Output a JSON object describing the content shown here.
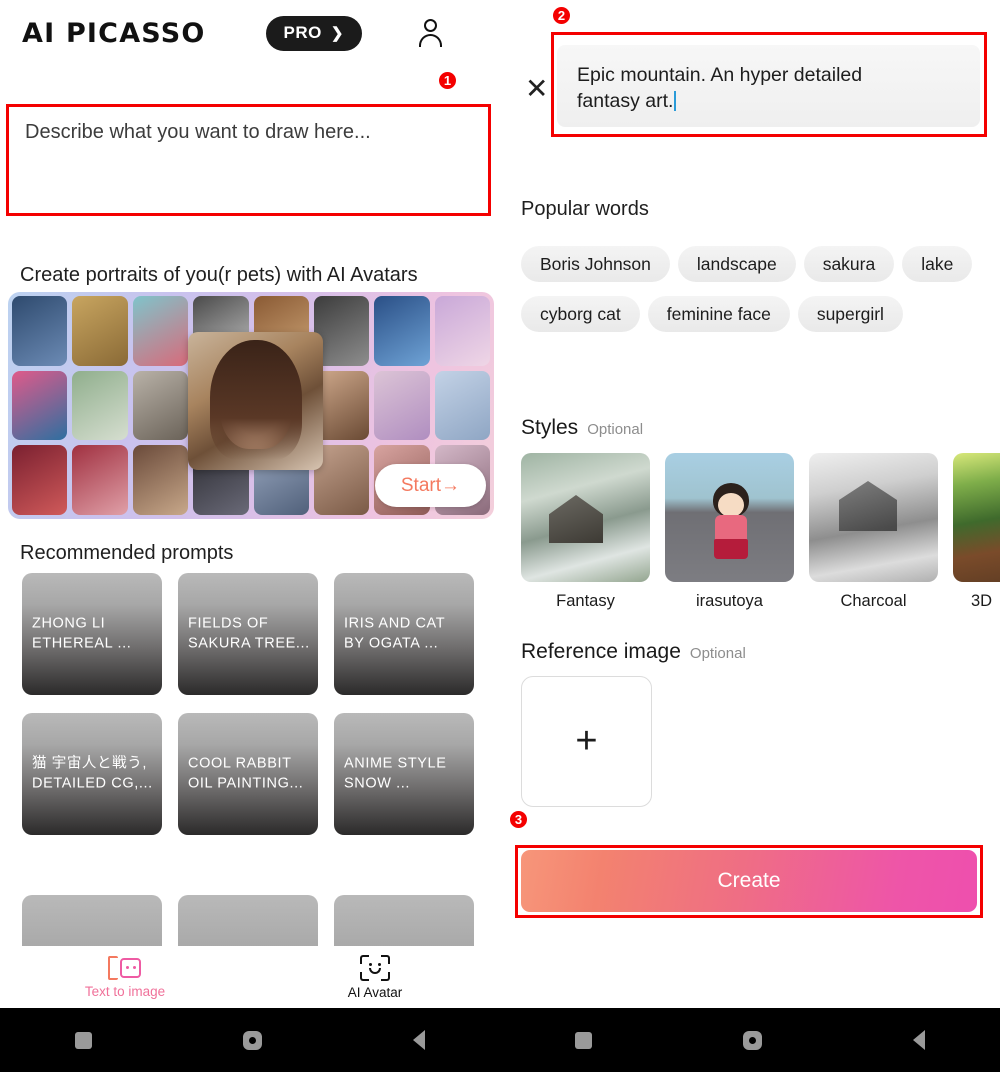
{
  "app": {
    "brand": "AI PICASSO",
    "pro_label": "PRO",
    "pro_caret": "❯"
  },
  "left": {
    "prompt_input": {
      "placeholder": "Describe what you want to draw here...",
      "value": ""
    },
    "avatar_banner": {
      "heading": "Create portraits of you(r pets) with AI Avatars",
      "start_label": "Start→"
    },
    "recommended": {
      "heading": "Recommended prompts",
      "cards": [
        "ZHONG LI ETHEREAL ...",
        "FIELDS OF SAKURA TREE...",
        "IRIS AND CAT BY OGATA ...",
        "猫 宇宙人と戦う, DETAILED CG,...",
        "COOL RABBIT OIL PAINTING...",
        "ANIME STYLE SNOW ..."
      ]
    },
    "bottom_nav": [
      {
        "label": "Text to image",
        "icon": "text-to-image-icon",
        "active": true
      },
      {
        "label": "AI Avatar",
        "icon": "ai-avatar-face-icon",
        "active": false
      }
    ]
  },
  "right": {
    "close_icon": "✕",
    "editor": {
      "value_line1": "Epic mountain. An hyper detailed",
      "value_line2": "fantasy art."
    },
    "popular_words": {
      "heading": "Popular words",
      "row1": [
        "Boris Johnson",
        "landscape",
        "sakura",
        "lake"
      ],
      "row2": [
        "cyborg cat",
        "feminine face",
        "supergirl"
      ]
    },
    "styles": {
      "heading": "Styles",
      "optional": "Optional",
      "items": [
        {
          "name": "Fantasy"
        },
        {
          "name": "irasutoya"
        },
        {
          "name": "Charcoal"
        },
        {
          "name": "3D"
        }
      ]
    },
    "reference_image": {
      "heading": "Reference image",
      "optional": "Optional",
      "add_label": "+"
    },
    "create_label": "Create"
  },
  "android_nav": {
    "recent": "recent-apps-icon",
    "home": "home-icon",
    "back": "back-icon"
  },
  "annotations": {
    "badge1": "1",
    "badge2": "2",
    "badge3": "3",
    "color": "#f40000"
  }
}
